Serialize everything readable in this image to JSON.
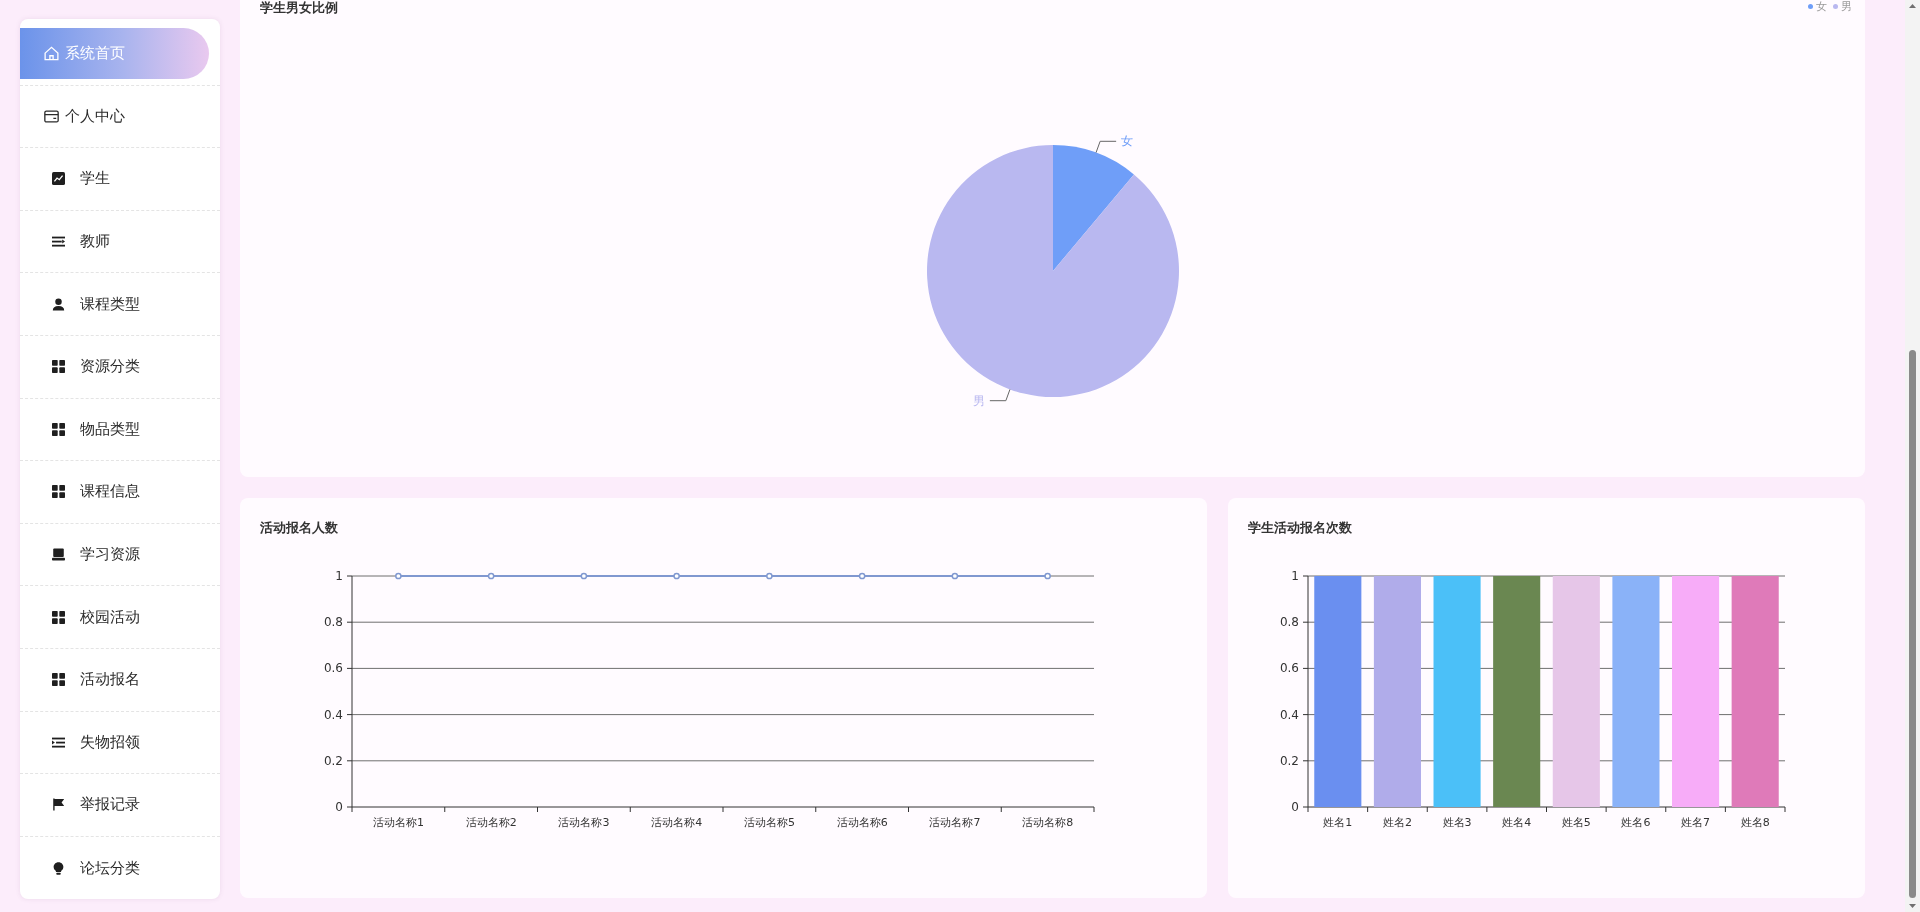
{
  "sidebar": {
    "items": [
      {
        "label": "系统首页",
        "kind": "main",
        "selected": true
      },
      {
        "label": "个人中心",
        "kind": "main",
        "selected": false
      },
      {
        "label": "学生",
        "kind": "module",
        "selected": false
      },
      {
        "label": "教师",
        "kind": "module",
        "selected": false
      },
      {
        "label": "课程类型",
        "kind": "module",
        "selected": false
      },
      {
        "label": "资源分类",
        "kind": "module",
        "selected": false
      },
      {
        "label": "物品类型",
        "kind": "module",
        "selected": false
      },
      {
        "label": "课程信息",
        "kind": "module",
        "selected": false
      },
      {
        "label": "学习资源",
        "kind": "module",
        "selected": false
      },
      {
        "label": "校园活动",
        "kind": "module",
        "selected": false
      },
      {
        "label": "活动报名",
        "kind": "module",
        "selected": false
      },
      {
        "label": "失物招领",
        "kind": "module",
        "selected": false
      },
      {
        "label": "举报记录",
        "kind": "module",
        "selected": false
      },
      {
        "label": "论坛分类",
        "kind": "module",
        "selected": false
      }
    ]
  },
  "gender_chart": {
    "legend": [
      {
        "label": "女",
        "color": "#6f9ef8"
      },
      {
        "label": "男",
        "color": "#b9b8f0"
      }
    ],
    "chart_data": {
      "type": "pie",
      "title": "学生男女比例",
      "categories": [
        "女",
        "男"
      ],
      "values": [
        11.1,
        88.9
      ]
    }
  },
  "signup_chart": {
    "chart_data": {
      "type": "line",
      "title": "活动报名人数",
      "categories": [
        "活动名称1",
        "活动名称2",
        "活动名称3",
        "活动名称4",
        "活动名称5",
        "活动名称6",
        "活动名称7",
        "活动名称8"
      ],
      "series": [
        {
          "color": "#8098d0",
          "marker": "circle",
          "values": [
            1,
            1,
            1,
            1,
            1,
            1,
            1,
            1
          ]
        }
      ],
      "ylim": [
        0,
        1
      ],
      "yticks": [
        0,
        0.2,
        0.4,
        0.6,
        0.8,
        1
      ],
      "grid": true
    }
  },
  "signup_count_chart": {
    "chart_data": {
      "type": "bar",
      "title": "学生活动报名次数",
      "categories": [
        "姓名1",
        "姓名2",
        "姓名3",
        "姓名4",
        "姓名5",
        "姓名6",
        "姓名7",
        "姓名8"
      ],
      "values": [
        1,
        1,
        1,
        1,
        1,
        1,
        1,
        1
      ],
      "colors": [
        "#6a8ff0",
        "#b0acea",
        "#4bc0f8",
        "#6a8751",
        "#e6c6e8",
        "#8ab2f8",
        "#f7acf8",
        "#df7ab9"
      ],
      "ylim": [
        0,
        1
      ],
      "yticks": [
        0,
        0.2,
        0.4,
        0.6,
        0.8,
        1
      ],
      "grid": true
    }
  }
}
